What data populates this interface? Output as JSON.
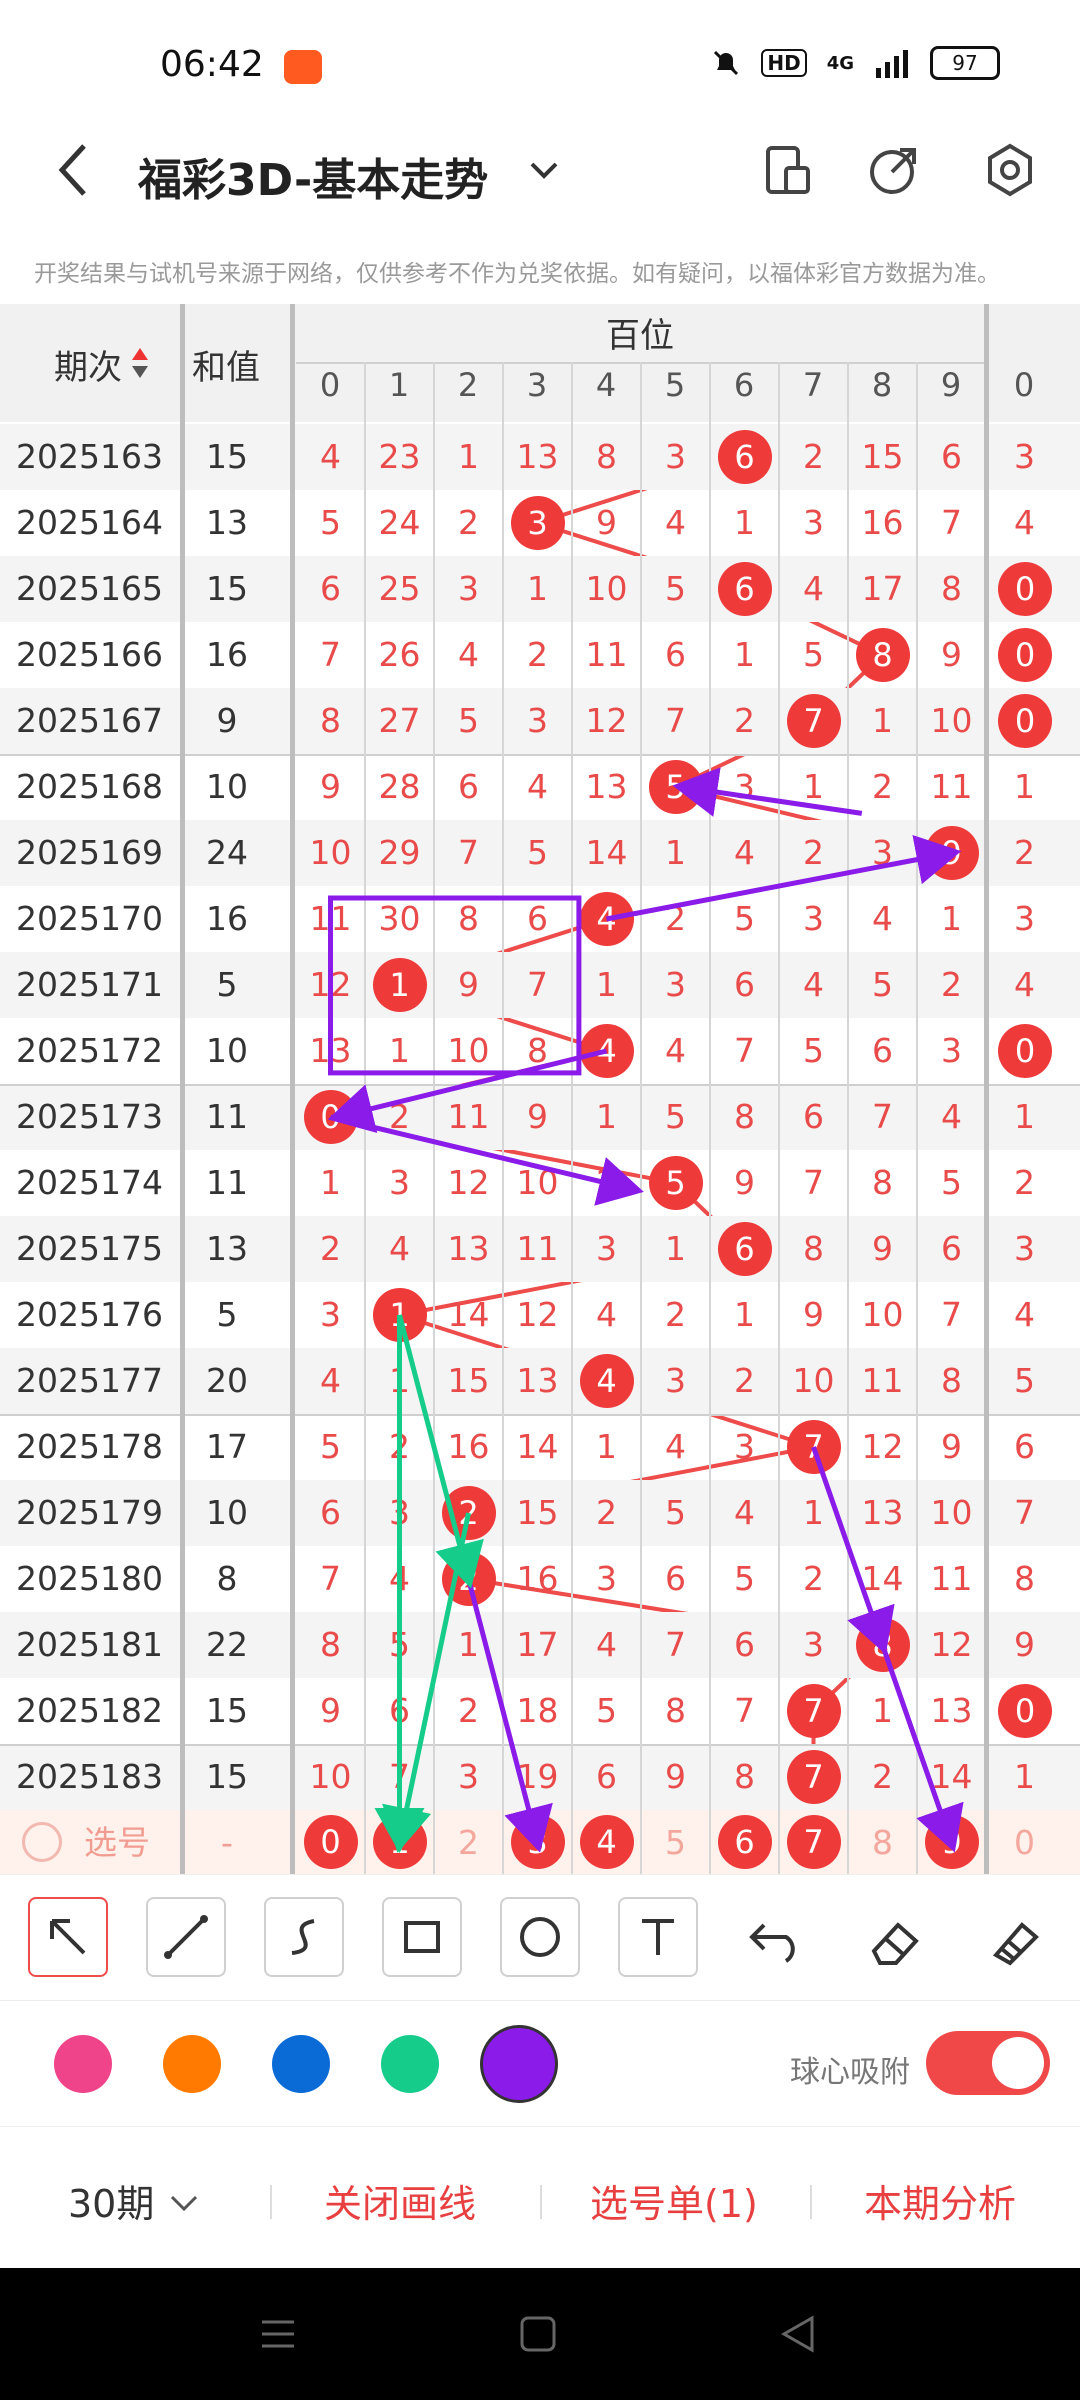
{
  "status_bar": {
    "time": "06:42",
    "network": "4G",
    "hd": "HD",
    "battery": "97"
  },
  "header": {
    "title": "福彩3D-基本走势"
  },
  "notice": "开奖结果与试机号来源于网络，仅供参考不作为兑奖依据。如有疑问，以福体彩官方数据为准。",
  "table": {
    "col_period": "期次",
    "col_sum": "和值",
    "group_label": "百位",
    "digits": [
      "0",
      "1",
      "2",
      "3",
      "4",
      "5",
      "6",
      "7",
      "8",
      "9"
    ],
    "next_digit": "0",
    "rows": [
      {
        "period": "2025163",
        "sum": "15",
        "cells": [
          "4",
          "23",
          "1",
          "13",
          "8",
          "3",
          "6",
          "2",
          "15",
          "6"
        ],
        "hit": 6,
        "next": "3",
        "next_hit": false
      },
      {
        "period": "2025164",
        "sum": "13",
        "cells": [
          "5",
          "24",
          "2",
          "3",
          "9",
          "4",
          "1",
          "3",
          "16",
          "7"
        ],
        "hit": 3,
        "next": "4",
        "next_hit": false
      },
      {
        "period": "2025165",
        "sum": "15",
        "cells": [
          "6",
          "25",
          "3",
          "1",
          "10",
          "5",
          "6",
          "4",
          "17",
          "8"
        ],
        "hit": 6,
        "next": "0",
        "next_hit": true
      },
      {
        "period": "2025166",
        "sum": "16",
        "cells": [
          "7",
          "26",
          "4",
          "2",
          "11",
          "6",
          "1",
          "5",
          "8",
          "9"
        ],
        "hit": 8,
        "next": "0",
        "next_hit": true
      },
      {
        "period": "2025167",
        "sum": "9",
        "cells": [
          "8",
          "27",
          "5",
          "3",
          "12",
          "7",
          "2",
          "7",
          "1",
          "10"
        ],
        "hit": 7,
        "next": "0",
        "next_hit": true
      },
      {
        "period": "2025168",
        "sum": "10",
        "cells": [
          "9",
          "28",
          "6",
          "4",
          "13",
          "5",
          "3",
          "1",
          "2",
          "11"
        ],
        "hit": 5,
        "next": "1",
        "next_hit": false
      },
      {
        "period": "2025169",
        "sum": "24",
        "cells": [
          "10",
          "29",
          "7",
          "5",
          "14",
          "1",
          "4",
          "2",
          "3",
          "9"
        ],
        "hit": 9,
        "next": "2",
        "next_hit": false
      },
      {
        "period": "2025170",
        "sum": "16",
        "cells": [
          "11",
          "30",
          "8",
          "6",
          "4",
          "2",
          "5",
          "3",
          "4",
          "1"
        ],
        "hit": 4,
        "next": "3",
        "next_hit": false
      },
      {
        "period": "2025171",
        "sum": "5",
        "cells": [
          "12",
          "1",
          "9",
          "7",
          "1",
          "3",
          "6",
          "4",
          "5",
          "2"
        ],
        "hit": 1,
        "next": "4",
        "next_hit": false
      },
      {
        "period": "2025172",
        "sum": "10",
        "cells": [
          "13",
          "1",
          "10",
          "8",
          "4",
          "4",
          "7",
          "5",
          "6",
          "3"
        ],
        "hit": 4,
        "next": "0",
        "next_hit": true
      },
      {
        "period": "2025173",
        "sum": "11",
        "cells": [
          "0",
          "2",
          "11",
          "9",
          "1",
          "5",
          "8",
          "6",
          "7",
          "4"
        ],
        "hit": 0,
        "next": "1",
        "next_hit": false
      },
      {
        "period": "2025174",
        "sum": "11",
        "cells": [
          "1",
          "3",
          "12",
          "10",
          "2",
          "5",
          "9",
          "7",
          "8",
          "5"
        ],
        "hit": 5,
        "next": "2",
        "next_hit": false
      },
      {
        "period": "2025175",
        "sum": "13",
        "cells": [
          "2",
          "4",
          "13",
          "11",
          "3",
          "1",
          "6",
          "8",
          "9",
          "6"
        ],
        "hit": 6,
        "next": "3",
        "next_hit": false
      },
      {
        "period": "2025176",
        "sum": "5",
        "cells": [
          "3",
          "1",
          "14",
          "12",
          "4",
          "2",
          "1",
          "9",
          "10",
          "7"
        ],
        "hit": 1,
        "next": "4",
        "next_hit": false
      },
      {
        "period": "2025177",
        "sum": "20",
        "cells": [
          "4",
          "1",
          "15",
          "13",
          "4",
          "3",
          "2",
          "10",
          "11",
          "8"
        ],
        "hit": 4,
        "next": "5",
        "next_hit": false
      },
      {
        "period": "2025178",
        "sum": "17",
        "cells": [
          "5",
          "2",
          "16",
          "14",
          "1",
          "4",
          "3",
          "7",
          "12",
          "9"
        ],
        "hit": 7,
        "next": "6",
        "next_hit": false
      },
      {
        "period": "2025179",
        "sum": "10",
        "cells": [
          "6",
          "3",
          "2",
          "15",
          "2",
          "5",
          "4",
          "1",
          "13",
          "10"
        ],
        "hit": 2,
        "next": "7",
        "next_hit": false
      },
      {
        "period": "2025180",
        "sum": "8",
        "cells": [
          "7",
          "4",
          "2",
          "16",
          "3",
          "6",
          "5",
          "2",
          "14",
          "11"
        ],
        "hit": 2,
        "next": "8",
        "next_hit": false
      },
      {
        "period": "2025181",
        "sum": "22",
        "cells": [
          "8",
          "5",
          "1",
          "17",
          "4",
          "7",
          "6",
          "3",
          "8",
          "12"
        ],
        "hit": 8,
        "next": "9",
        "next_hit": false
      },
      {
        "period": "2025182",
        "sum": "15",
        "cells": [
          "9",
          "6",
          "2",
          "18",
          "5",
          "8",
          "7",
          "7",
          "1",
          "13"
        ],
        "hit": 7,
        "next": "0",
        "next_hit": true
      },
      {
        "period": "2025183",
        "sum": "15",
        "cells": [
          "10",
          "7",
          "3",
          "19",
          "6",
          "9",
          "8",
          "7",
          "2",
          "14"
        ],
        "hit": 7,
        "next": "1",
        "next_hit": false
      }
    ],
    "select_row": {
      "label": "选号",
      "sum": "-",
      "cells": [
        "0",
        "1",
        "2",
        "3",
        "4",
        "5",
        "6",
        "7",
        "8",
        "9"
      ],
      "selected": [
        true,
        true,
        false,
        true,
        true,
        false,
        true,
        true,
        false,
        true
      ],
      "next": "0"
    }
  },
  "drawing_colors": [
    "#f0448a",
    "#ff7a00",
    "#0a6ad6",
    "#16cc8a",
    "#8a1be8"
  ],
  "toolbar": {
    "snap_label": "球心吸附",
    "snap_on": true
  },
  "bottom_bar": {
    "periods": "30期",
    "close_drawing": "关闭画线",
    "pick_list": "选号单(1)",
    "analysis": "本期分析"
  }
}
